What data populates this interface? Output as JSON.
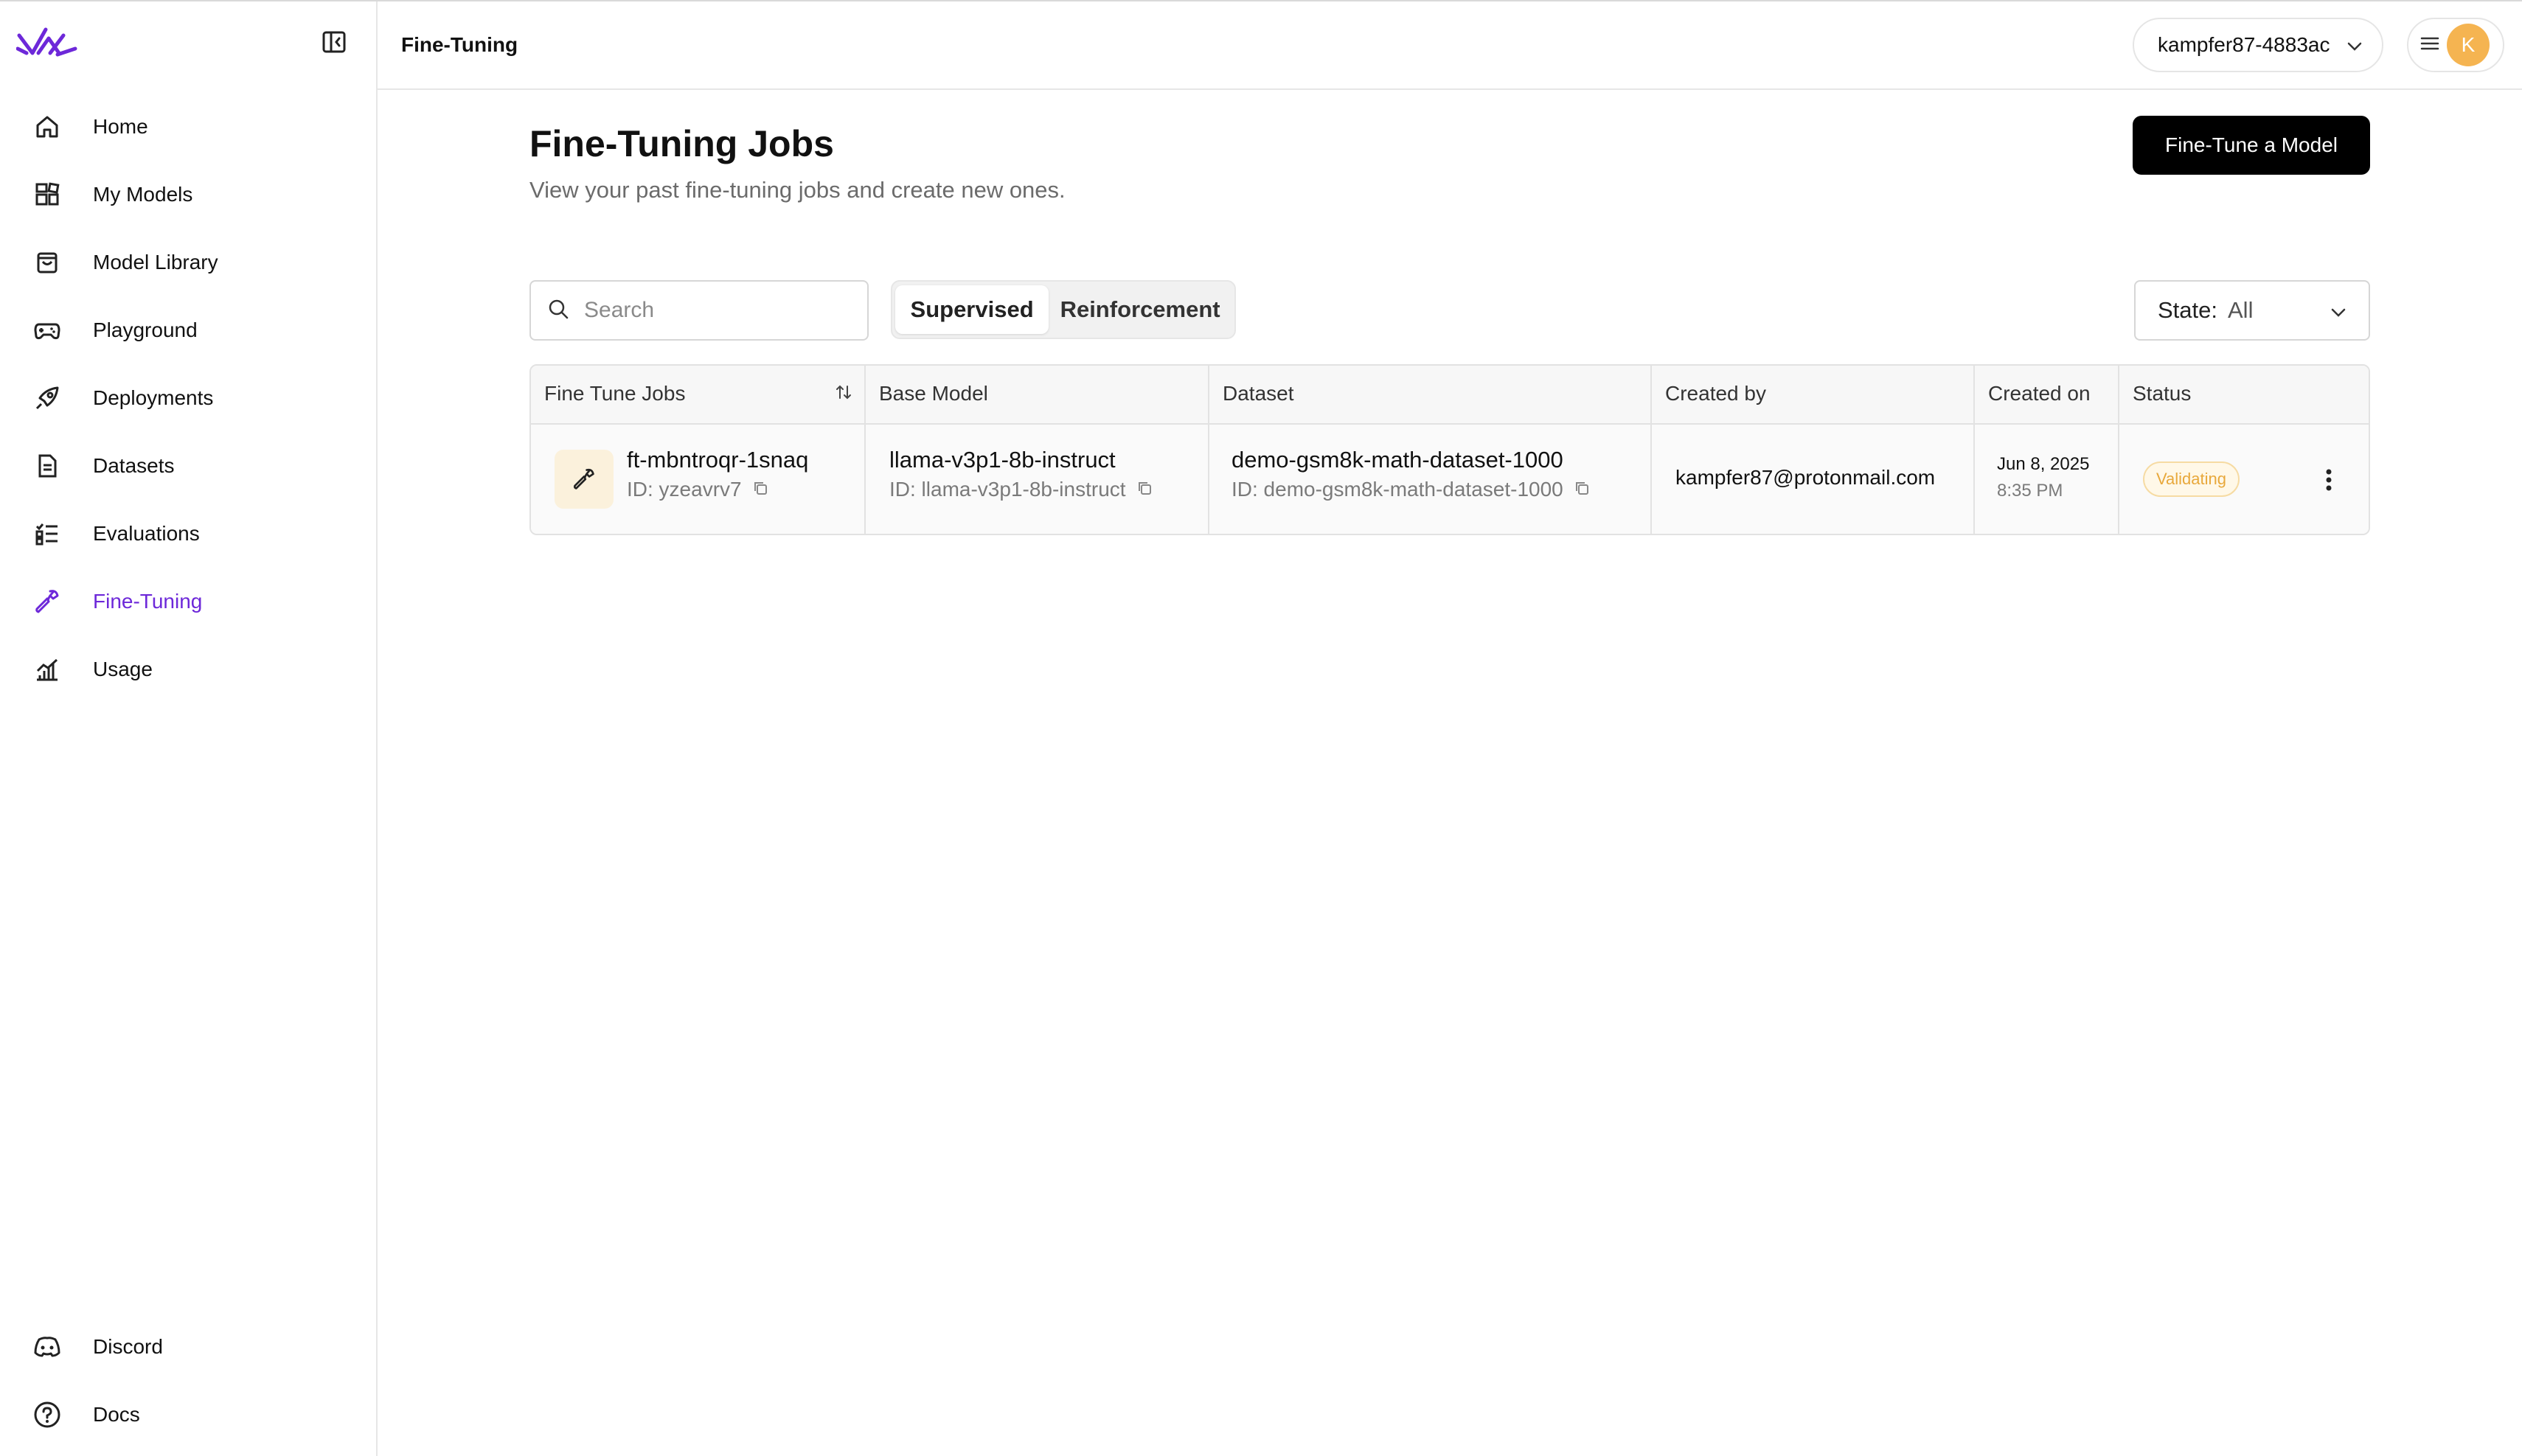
{
  "sidebar": {
    "items": [
      {
        "label": "Home",
        "icon": "home-icon"
      },
      {
        "label": "My Models",
        "icon": "models-icon"
      },
      {
        "label": "Model Library",
        "icon": "shopping-bag-icon"
      },
      {
        "label": "Playground",
        "icon": "gamepad-icon"
      },
      {
        "label": "Deployments",
        "icon": "rocket-icon"
      },
      {
        "label": "Datasets",
        "icon": "document-icon"
      },
      {
        "label": "Evaluations",
        "icon": "checklist-icon"
      },
      {
        "label": "Fine-Tuning",
        "icon": "wrench-icon",
        "active": true
      },
      {
        "label": "Usage",
        "icon": "bar-chart-icon"
      }
    ],
    "bottom_items": [
      {
        "label": "Discord",
        "icon": "discord-icon"
      },
      {
        "label": "Docs",
        "icon": "help-circle-icon"
      }
    ]
  },
  "header": {
    "breadcrumb": "Fine-Tuning",
    "account": "kampfer87-4883ac",
    "avatar_initial": "K"
  },
  "main": {
    "title": "Fine-Tuning Jobs",
    "subtitle": "View your past fine-tuning jobs and create new ones.",
    "primary_button": "Fine-Tune a Model",
    "search_placeholder": "Search",
    "tabs": [
      {
        "label": "Supervised",
        "active": true
      },
      {
        "label": "Reinforcement",
        "active": false
      }
    ],
    "state_filter": {
      "label": "State:",
      "value": "All"
    }
  },
  "table": {
    "columns": [
      "Fine Tune Jobs",
      "Base Model",
      "Dataset",
      "Created by",
      "Created on",
      "Status"
    ],
    "rows": [
      {
        "job_name": "ft-mbntroqr-1snaq",
        "job_id": "ID: yzeavrv7",
        "base_model": "llama-v3p1-8b-instruct",
        "base_model_id": "ID: llama-v3p1-8b-instruct",
        "dataset": "demo-gsm8k-math-dataset-1000",
        "dataset_id": "ID: demo-gsm8k-math-dataset-1000",
        "created_by": "kampfer87@protonmail.com",
        "created_date": "Jun 8, 2025",
        "created_time": "8:35 PM",
        "status": "Validating"
      }
    ]
  },
  "colors": {
    "accent": "#6d28d9",
    "avatar": "#f5b451",
    "status_validating": "#e8a83b"
  }
}
